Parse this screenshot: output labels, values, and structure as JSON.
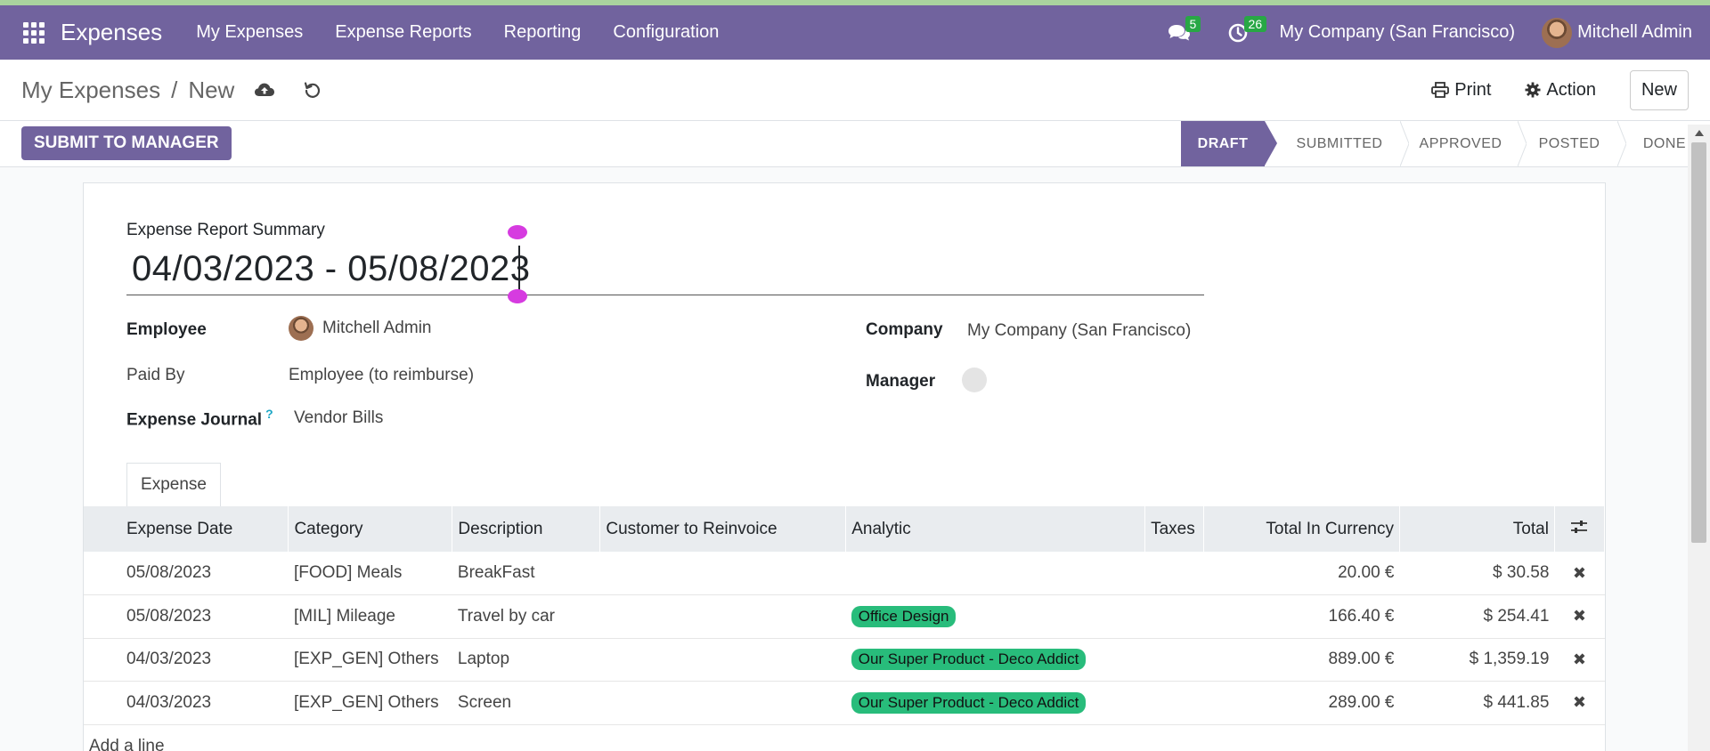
{
  "navbar": {
    "app_name": "Expenses",
    "menu": [
      "My Expenses",
      "Expense Reports",
      "Reporting",
      "Configuration"
    ],
    "messages_count": "5",
    "activities_count": "26",
    "company": "My Company (San Francisco)",
    "user": "Mitchell Admin"
  },
  "breadcrumb": {
    "parent": "My Expenses",
    "separator": "/",
    "current": "New"
  },
  "control": {
    "print_label": "Print",
    "action_label": "Action",
    "new_label": "New"
  },
  "status": {
    "submit_label": "SUBMIT TO MANAGER",
    "stages": [
      "DRAFT",
      "SUBMITTED",
      "APPROVED",
      "POSTED",
      "DONE"
    ],
    "active": "DRAFT"
  },
  "form": {
    "summary_label": "Expense Report Summary",
    "summary_value": "04/03/2023 - 05/08/2023",
    "employee_label": "Employee",
    "employee_value": "Mitchell Admin",
    "paid_by_label": "Paid By",
    "paid_by_value": "Employee (to reimburse)",
    "journal_label": "Expense Journal",
    "journal_help": "?",
    "journal_value": "Vendor Bills",
    "company_label": "Company",
    "company_value": "My Company (San Francisco)",
    "manager_label": "Manager"
  },
  "tabs": [
    "Expense"
  ],
  "lines": {
    "headers": [
      "Expense Date",
      "Category",
      "Description",
      "Customer to Reinvoice",
      "Analytic",
      "Taxes",
      "Total In Currency",
      "Total"
    ],
    "rows": [
      {
        "date": "05/08/2023",
        "category": "[FOOD] Meals",
        "description": "BreakFast",
        "customer": "",
        "analytic": "",
        "taxes": "",
        "total_currency": "20.00 €",
        "total": "$ 30.58"
      },
      {
        "date": "05/08/2023",
        "category": "[MIL] Mileage",
        "description": "Travel by car",
        "customer": "",
        "analytic": "Office Design",
        "taxes": "",
        "total_currency": "166.40 €",
        "total": "$ 254.41"
      },
      {
        "date": "04/03/2023",
        "category": "[EXP_GEN] Others",
        "description": "Laptop",
        "customer": "",
        "analytic": "Our Super Product - Deco Addict",
        "taxes": "",
        "total_currency": "889.00 €",
        "total": "$ 1,359.19"
      },
      {
        "date": "04/03/2023",
        "category": "[EXP_GEN] Others",
        "description": "Screen",
        "customer": "",
        "analytic": "Our Super Product - Deco Addict",
        "taxes": "",
        "total_currency": "289.00 €",
        "total": "$ 441.85"
      }
    ],
    "add_line_label": "Add a line",
    "delete_glyph": "✖"
  }
}
